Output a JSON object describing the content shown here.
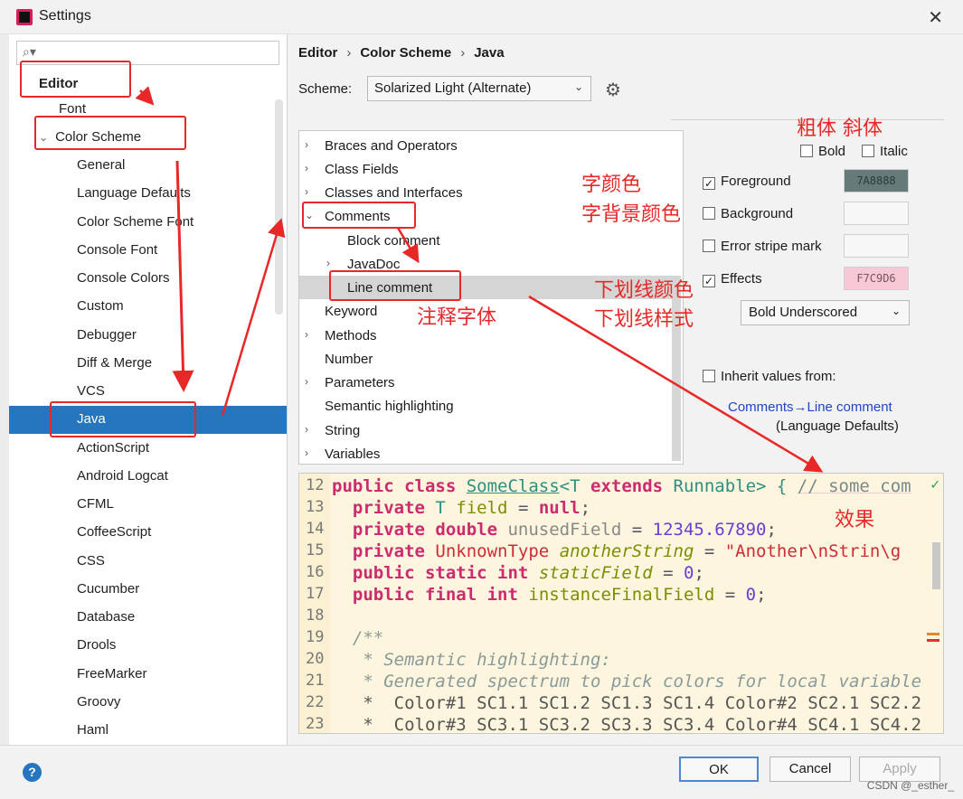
{
  "window": {
    "title": "Settings"
  },
  "sidebar": {
    "items": [
      {
        "label": "Editor"
      },
      {
        "label": "Font"
      },
      {
        "label": "Color Scheme"
      },
      {
        "label": "General"
      },
      {
        "label": "Language Defaults"
      },
      {
        "label": "Color Scheme Font"
      },
      {
        "label": "Console Font"
      },
      {
        "label": "Console Colors"
      },
      {
        "label": "Custom"
      },
      {
        "label": "Debugger"
      },
      {
        "label": "Diff & Merge"
      },
      {
        "label": "VCS"
      },
      {
        "label": "Java"
      },
      {
        "label": "ActionScript"
      },
      {
        "label": "Android Logcat"
      },
      {
        "label": "CFML"
      },
      {
        "label": "CoffeeScript"
      },
      {
        "label": "CSS"
      },
      {
        "label": "Cucumber"
      },
      {
        "label": "Database"
      },
      {
        "label": "Drools"
      },
      {
        "label": "FreeMarker"
      },
      {
        "label": "Groovy"
      },
      {
        "label": "Haml"
      }
    ]
  },
  "breadcrumb": [
    "Editor",
    "Color Scheme",
    "Java"
  ],
  "scheme": {
    "label": "Scheme:",
    "value": "Solarized Light (Alternate)"
  },
  "tree": {
    "items": [
      {
        "label": "Braces and Operators"
      },
      {
        "label": "Class Fields"
      },
      {
        "label": "Classes and Interfaces"
      },
      {
        "label": "Comments"
      },
      {
        "label": "Block comment"
      },
      {
        "label": "JavaDoc"
      },
      {
        "label": "Line comment"
      },
      {
        "label": "Keyword"
      },
      {
        "label": "Methods"
      },
      {
        "label": "Number"
      },
      {
        "label": "Parameters"
      },
      {
        "label": "Semantic highlighting"
      },
      {
        "label": "String"
      },
      {
        "label": "Variables"
      }
    ]
  },
  "options": {
    "bold": "Bold",
    "italic": "Italic",
    "foreground": "Foreground",
    "foreground_color": "7A8888",
    "background": "Background",
    "error_stripe": "Error stripe mark",
    "effects": "Effects",
    "effects_color": "F7C9D6",
    "effect_type": "Bold Underscored",
    "inherit": "Inherit values from:",
    "inherit_link": "Comments→Line comment",
    "inherit_sub": "(Language Defaults)"
  },
  "preview": {
    "line_numbers": [
      "12",
      "13",
      "14",
      "15",
      "16",
      "17",
      "18",
      "19",
      "20",
      "21",
      "22",
      "23"
    ],
    "lines": [
      [
        "public",
        " class ",
        "SomeClass",
        "<T ",
        "extends",
        " Runnable> { ",
        "// some com"
      ],
      [
        "private",
        " T ",
        "field",
        " = ",
        "null",
        ";"
      ],
      [
        "private",
        " double",
        " unusedField",
        " = ",
        "12345.67890",
        ";"
      ],
      [
        "private",
        " UnknownType",
        " anotherString",
        " = ",
        "\"Another\\nStrin\\g"
      ],
      [
        "public",
        " static",
        " int",
        " staticField",
        " = ",
        "0",
        ";"
      ],
      [
        "public",
        " final",
        " int",
        " instanceFinalField",
        " = ",
        "0",
        ";"
      ],
      [
        ""
      ],
      [
        "/**"
      ],
      [
        " * Semantic highlighting:"
      ],
      [
        " * Generated spectrum to pick colors for local variable"
      ],
      [
        " *  Color#1 SC1.1 SC1.2 SC1.3 SC1.4 Color#2 SC2.1 SC2.2"
      ],
      [
        " *  Color#3 SC3.1 SC3.2 SC3.3 SC3.4 Color#4 SC4.1 SC4.2"
      ]
    ]
  },
  "buttons": {
    "help": "?",
    "ok": "OK",
    "cancel": "Cancel",
    "apply": "Apply"
  },
  "watermark": "CSDN @_esther_",
  "annotations": {
    "bold_italic_label": "粗体  斜体",
    "font_color": "字颜色",
    "font_bg_color": "字背景颜色",
    "underline_color": "下划线颜色",
    "underline_style": "下划线样式",
    "comment_font": "注释字体",
    "effect": "效果"
  },
  "colors": {
    "accent": "#2675bf",
    "annotation": "#e82727",
    "preview_bg": "#fdf5dd"
  }
}
